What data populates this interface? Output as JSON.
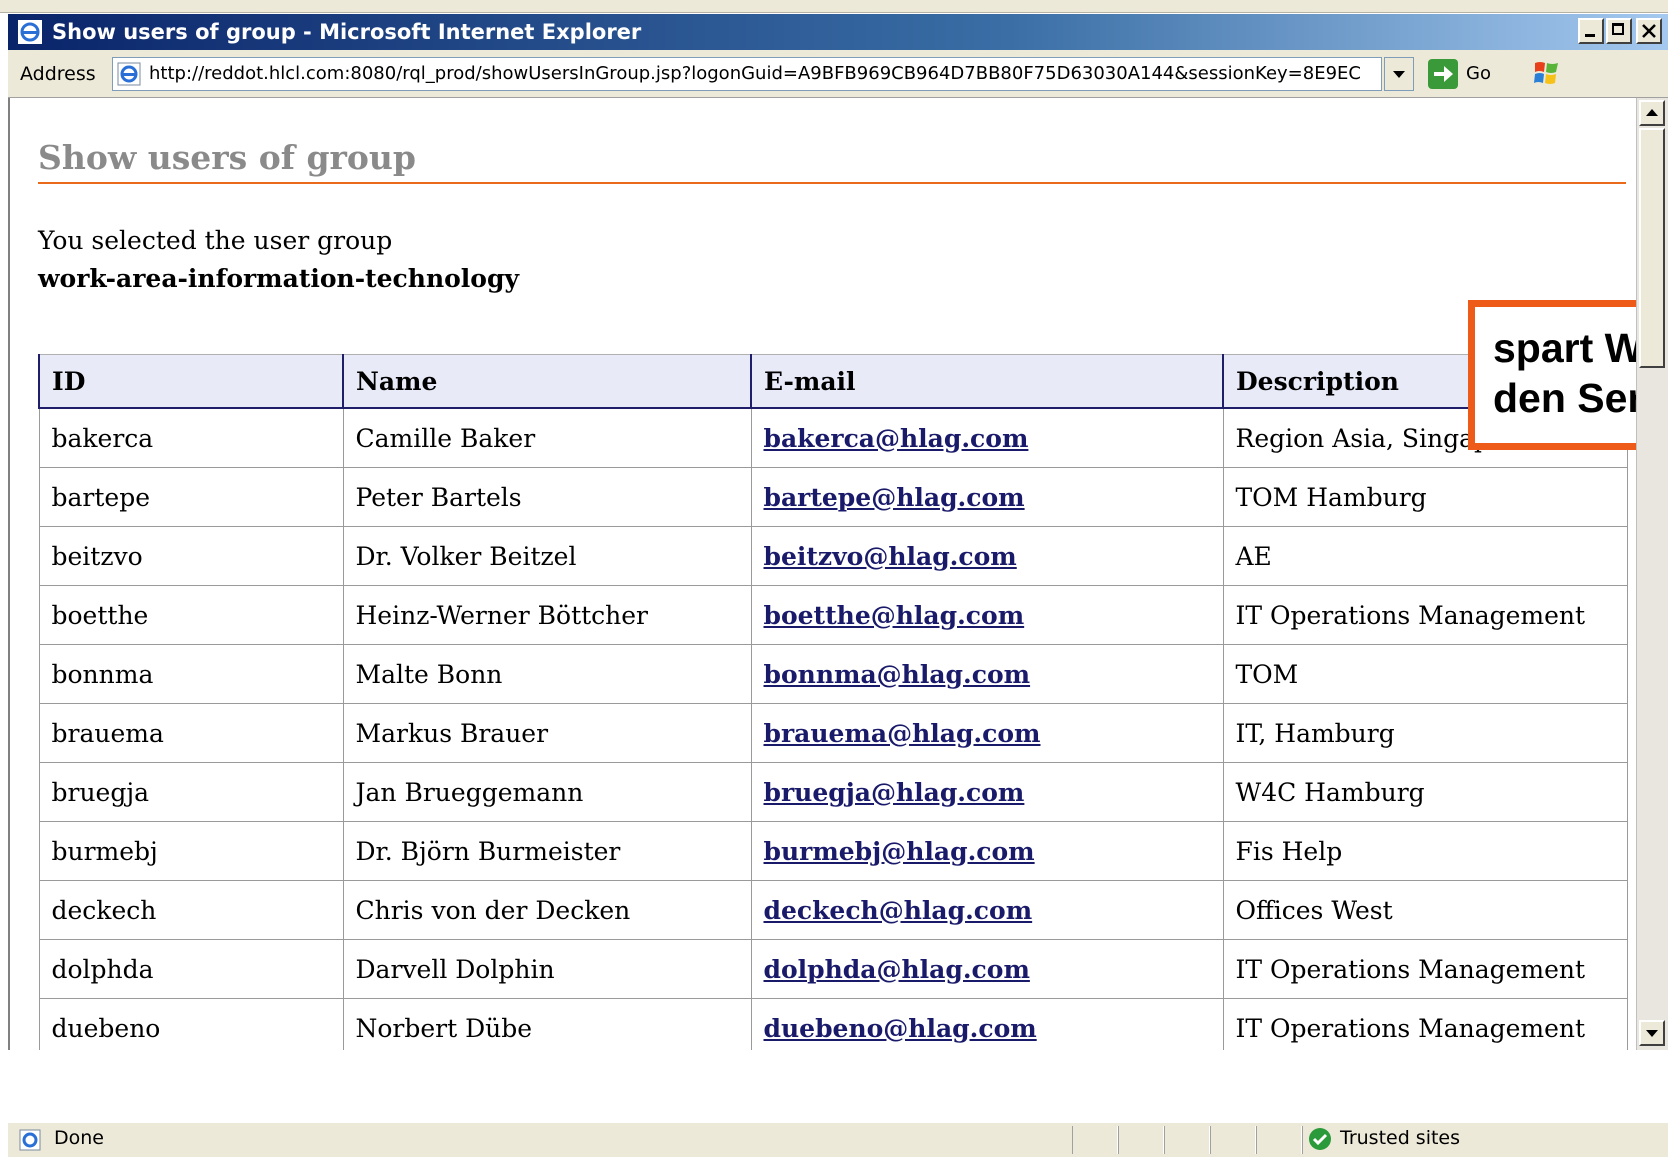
{
  "window": {
    "title": "Show users of group - Microsoft Internet Explorer"
  },
  "addressbar": {
    "label": "Address",
    "url": "http://reddot.hlcl.com:8080/rql_prod/showUsersInGroup.jsp?logonGuid=A9BFB969CB964D7BB80F75D63030A144&sessionKey=8E9EC",
    "go_label": "Go"
  },
  "page": {
    "title": "Show users of group",
    "intro": "You selected the user group",
    "group_name": "work-area-information-technology"
  },
  "table": {
    "headers": [
      "ID",
      "Name",
      "E-mail",
      "Description"
    ],
    "rows": [
      {
        "id": "bakerca",
        "name": "Camille Baker",
        "email": "bakerca@hlag.com",
        "description": "Region Asia, Singapore"
      },
      {
        "id": "bartepe",
        "name": "Peter Bartels",
        "email": "bartepe@hlag.com",
        "description": "TOM Hamburg"
      },
      {
        "id": "beitzvo",
        "name": "Dr. Volker Beitzel",
        "email": "beitzvo@hlag.com",
        "description": "AE"
      },
      {
        "id": "boetthe",
        "name": "Heinz-Werner Böttcher",
        "email": "boetthe@hlag.com",
        "description": "IT Operations Management"
      },
      {
        "id": "bonnma",
        "name": "Malte Bonn",
        "email": "bonnma@hlag.com",
        "description": "TOM"
      },
      {
        "id": "brauema",
        "name": "Markus Brauer",
        "email": "brauema@hlag.com",
        "description": "IT, Hamburg"
      },
      {
        "id": "bruegja",
        "name": "Jan Brueggemann",
        "email": "bruegja@hlag.com",
        "description": "W4C Hamburg"
      },
      {
        "id": "burmebj",
        "name": "Dr. Björn Burmeister",
        "email": "burmebj@hlag.com",
        "description": "Fis Help"
      },
      {
        "id": "deckech",
        "name": "Chris von der Decken",
        "email": "deckech@hlag.com",
        "description": "Offices West"
      },
      {
        "id": "dolphda",
        "name": "Darvell Dolphin",
        "email": "dolphda@hlag.com",
        "description": "IT Operations Management"
      },
      {
        "id": "duebeno",
        "name": "Norbert Dübe",
        "email": "duebeno@hlag.com",
        "description": "IT Operations Management"
      }
    ]
  },
  "callout": {
    "line1": "spart W",
    "line2": "den Ser"
  },
  "statusbar": {
    "status": "Done",
    "zone": "Trusted sites"
  },
  "colors": {
    "titlebar": "#0a246a",
    "accent_rule": "#e86a1a",
    "callout_border": "#ee5a18",
    "link": "#1a1a6a",
    "header_bg": "#e8eaf8"
  }
}
